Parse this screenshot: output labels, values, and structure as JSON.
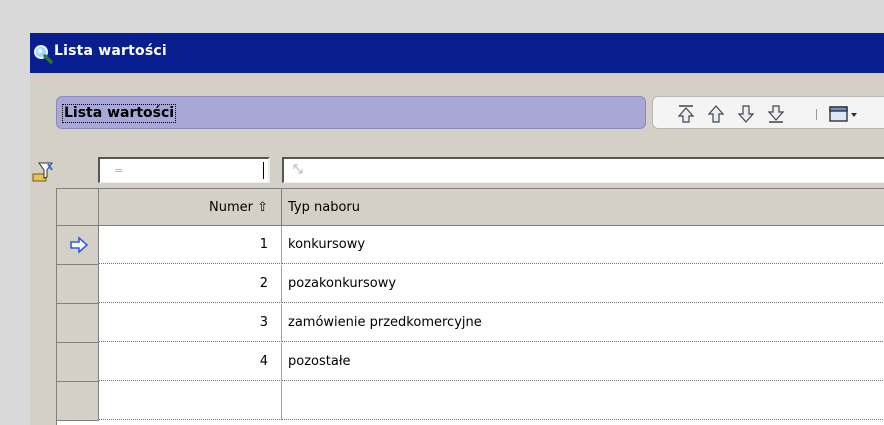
{
  "window": {
    "title": "Lista wartości"
  },
  "panel": {
    "label": "Lista wartości"
  },
  "filter": {
    "numer_placeholder": "="
  },
  "table": {
    "columns": [
      {
        "label": "Numer ⇧"
      },
      {
        "label": "Typ naboru"
      }
    ],
    "rows": [
      {
        "numer": "1",
        "typ": "konkursowy",
        "current": true
      },
      {
        "numer": "2",
        "typ": "pozakonkursowy",
        "current": false
      },
      {
        "numer": "3",
        "typ": "zamówienie przedkomercyjne",
        "current": false
      },
      {
        "numer": "4",
        "typ": "pozostałe",
        "current": false
      }
    ]
  },
  "icons": {
    "title": "magnifier-icon",
    "filter": "funnel-filter-icon",
    "row_pointer": "arrow-right-icon",
    "nav": [
      "first-record-icon",
      "previous-record-icon",
      "next-record-icon",
      "last-record-icon",
      "window-menu-icon"
    ]
  },
  "colors": {
    "titlebar": "#0a1f8f",
    "panel": "#a9a7d6",
    "grid_header": "#d4d0c8"
  }
}
